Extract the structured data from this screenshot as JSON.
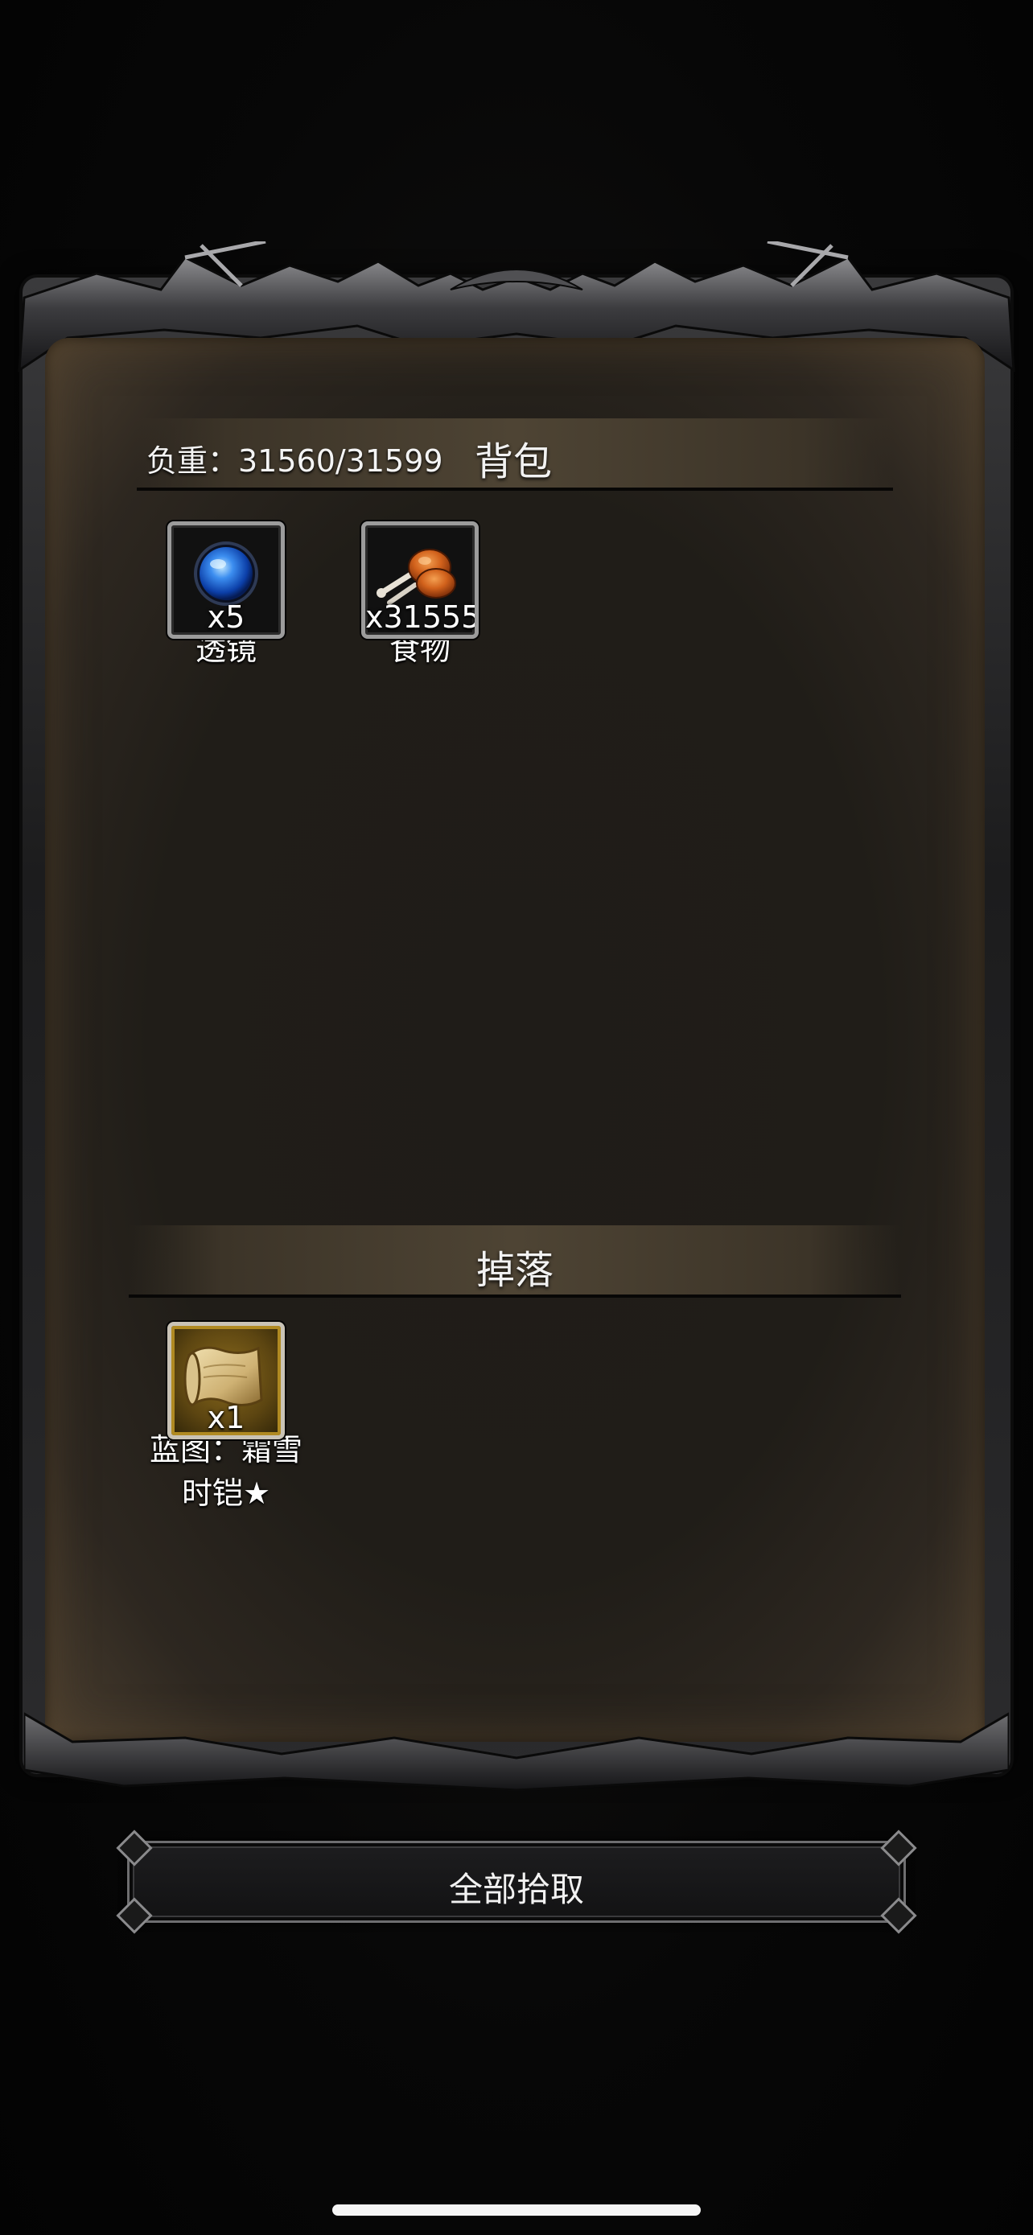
{
  "bag": {
    "title": "背包",
    "weight_label": "负重：31560/31599",
    "items": [
      {
        "name": "透镜",
        "quantity": "x5",
        "icon": "blue-orb-lens-icon"
      },
      {
        "name": "食物",
        "quantity": "x31555",
        "icon": "roasted-meat-icon"
      }
    ]
  },
  "drop": {
    "title": "掉落",
    "items": [
      {
        "name_line1": "蓝图：霜雪",
        "name_line2": "时铠★",
        "quantity": "x1",
        "icon": "blueprint-scroll-icon"
      }
    ]
  },
  "actions": {
    "pickup_all_label": "全部拾取"
  },
  "colors": {
    "panel_bg": "#201d18",
    "header_band": "#4e4434",
    "frame_metal": "#3a3a3c",
    "gold_slot": "#b08a22"
  }
}
